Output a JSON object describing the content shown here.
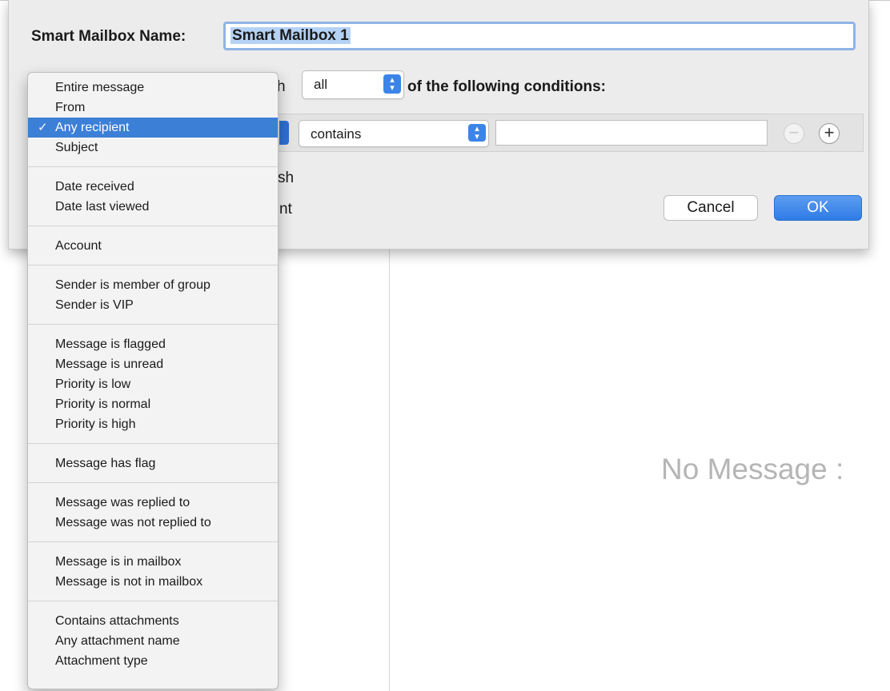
{
  "dialog": {
    "name_label": "Smart Mailbox Name:",
    "name_value": "Smart Mailbox 1",
    "match_tail": "h",
    "match_mode": "all",
    "following_text": "of the following conditions:",
    "condition_operator": "contains",
    "condition_value": "",
    "minus_label": "−",
    "plus_label": "+",
    "clipped_line_1": "sh",
    "clipped_line_2": "nt",
    "cancel_label": "Cancel",
    "ok_label": "OK"
  },
  "menu": {
    "groups": [
      [
        "Entire message",
        "From",
        "Any recipient",
        "Subject"
      ],
      [
        "Date received",
        "Date last viewed"
      ],
      [
        "Account"
      ],
      [
        "Sender is member of group",
        "Sender is VIP"
      ],
      [
        "Message is flagged",
        "Message is unread",
        "Priority is low",
        "Priority is normal",
        "Priority is high"
      ],
      [
        "Message has flag"
      ],
      [
        "Message was replied to",
        "Message was not replied to"
      ],
      [
        "Message is in mailbox",
        "Message is not in mailbox"
      ],
      [
        "Contains attachments",
        "Any attachment name",
        "Attachment type"
      ]
    ],
    "selected": "Any recipient",
    "check_glyph": "✓"
  },
  "main": {
    "no_message_text": "No Message :"
  },
  "colors": {
    "accent": "#3c7fd6",
    "sheet_bg": "#ececec",
    "menu_bg": "#f3f3f3"
  }
}
